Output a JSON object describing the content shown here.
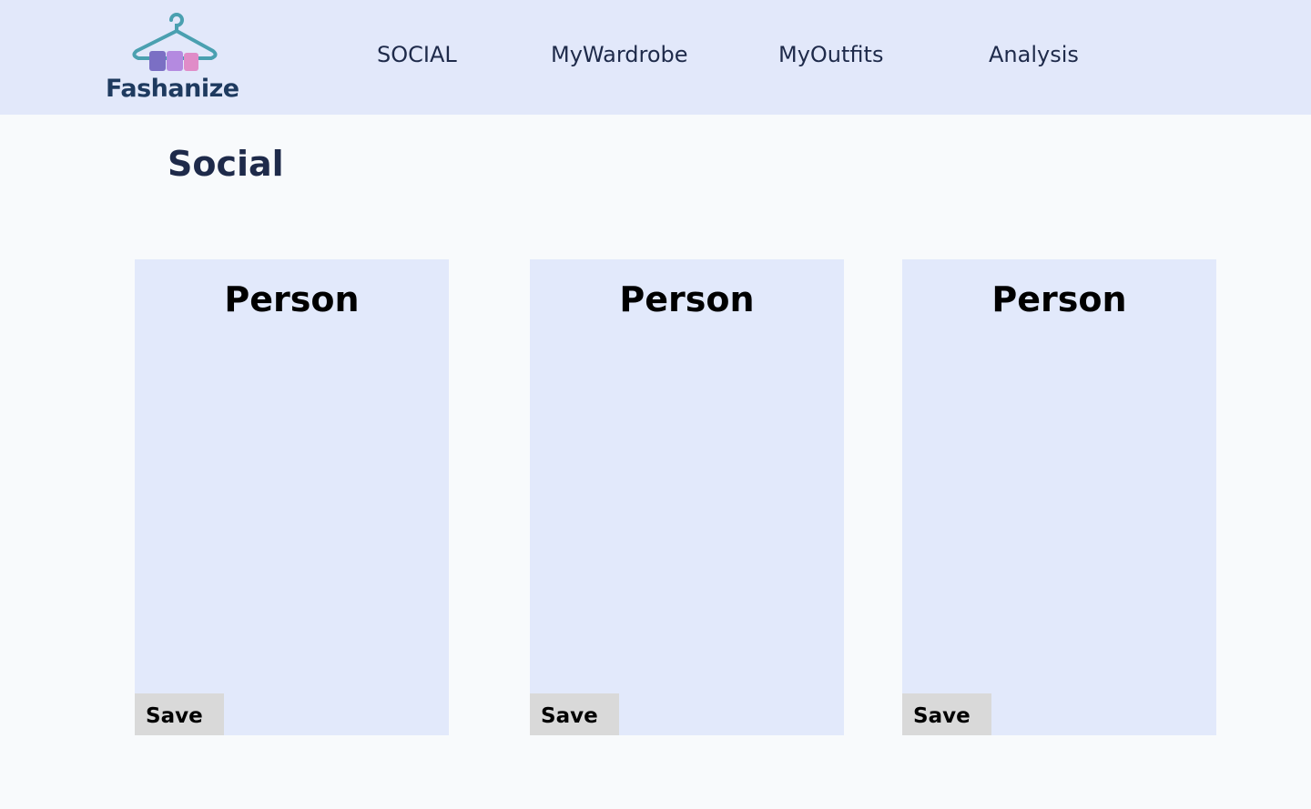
{
  "header": {
    "logo_text": "Fashanize",
    "nav": [
      {
        "label": "SOCIAL"
      },
      {
        "label": "MyWardrobe"
      },
      {
        "label": "MyOutfits"
      },
      {
        "label": "Analysis"
      }
    ]
  },
  "main": {
    "title": "Social",
    "cards": [
      {
        "title": "Person",
        "save_label": "Save"
      },
      {
        "title": "Person",
        "save_label": "Save"
      },
      {
        "title": "Person",
        "save_label": "Save"
      }
    ]
  },
  "colors": {
    "header_bg": "#e2e8fa",
    "page_bg": "#f8fafc",
    "card_bg": "#e2e9fb",
    "button_bg": "#d9d9d9",
    "text_dark": "#1e2a4a",
    "hanger": "#4aa0b0",
    "clothes": [
      "#7b6fc4",
      "#b48ae0",
      "#e08cc8"
    ]
  }
}
